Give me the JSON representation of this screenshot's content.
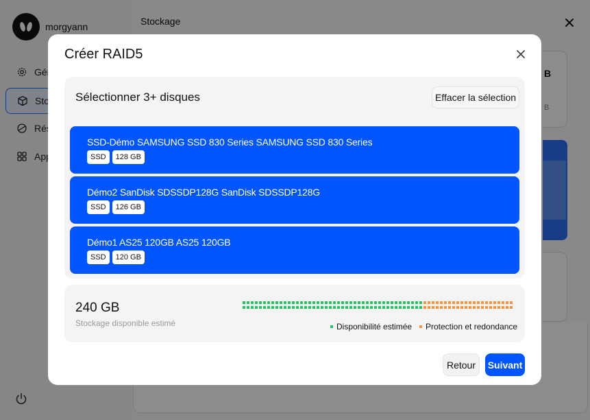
{
  "app": {
    "username": "morgyann",
    "nav": [
      {
        "label": "Général",
        "icon": "gear-icon"
      },
      {
        "label": "Stockage",
        "icon": "cube-icon"
      },
      {
        "label": "Réseau",
        "icon": "globe-icon"
      },
      {
        "label": "Applications",
        "icon": "apps-grid-icon"
      }
    ],
    "active_nav": "Stockage",
    "page_title": "Stockage",
    "bg_card_value": "B",
    "bg_card_unit": "B"
  },
  "modal": {
    "title": "Créer RAID5",
    "select_heading": "Sélectionner 3+ disques",
    "clear_label": "Effacer la sélection",
    "disks": [
      {
        "name": "SSD-Démo SAMSUNG SSD 830 Series SAMSUNG SSD 830 Series",
        "type": "SSD",
        "size": "128 GB",
        "selected": true
      },
      {
        "name": "Démo2 SanDisk SDSSDP128G SanDisk SDSSDP128G",
        "type": "SSD",
        "size": "126 GB",
        "selected": true
      },
      {
        "name": "Démo1 AS25 120GB AS25 120GB",
        "type": "SSD",
        "size": "120 GB",
        "selected": true
      }
    ],
    "capacity": {
      "value": "240 GB",
      "label": "Stockage disponible estimé",
      "available_fraction": 0.67,
      "legend_available": "Disponibilité estimée",
      "legend_protection": "Protection et redondance",
      "color_available": "#22c55e",
      "color_protection": "#fb923c"
    },
    "back_label": "Retour",
    "next_label": "Suivant"
  },
  "colors": {
    "accent": "#0055ff"
  }
}
